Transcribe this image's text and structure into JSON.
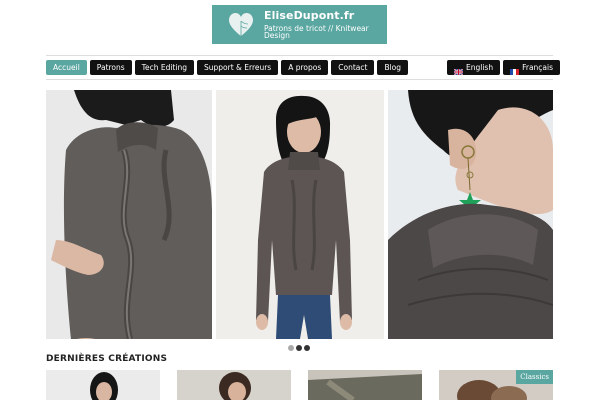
{
  "logo": {
    "name": "EliseDupont.fr",
    "tagline": "Patrons de tricot // Knitwear Design",
    "brand_color": "#5aa6a1"
  },
  "nav": {
    "items": [
      {
        "label": "Accueil",
        "active": true
      },
      {
        "label": "Patrons"
      },
      {
        "label": "Tech Editing"
      },
      {
        "label": "Support & Erreurs"
      },
      {
        "label": "A propos"
      },
      {
        "label": "Contact"
      },
      {
        "label": "Blog"
      }
    ]
  },
  "languages": [
    {
      "label": "English",
      "icon": "uk-flag-icon"
    },
    {
      "label": "Français",
      "icon": "france-flag-icon"
    }
  ],
  "slideshow": {
    "slides": [
      {
        "subject": "cable sweater detail"
      },
      {
        "subject": "woman in grey sweater"
      },
      {
        "subject": "cowl neck and earring"
      }
    ],
    "active_index": 0,
    "total": 3
  },
  "latest": {
    "title": "DERNIÈRES CRÉATIONS",
    "badge": "Classics"
  },
  "colors": {
    "accent": "#5aa6a1",
    "nav_bg": "#111111"
  }
}
